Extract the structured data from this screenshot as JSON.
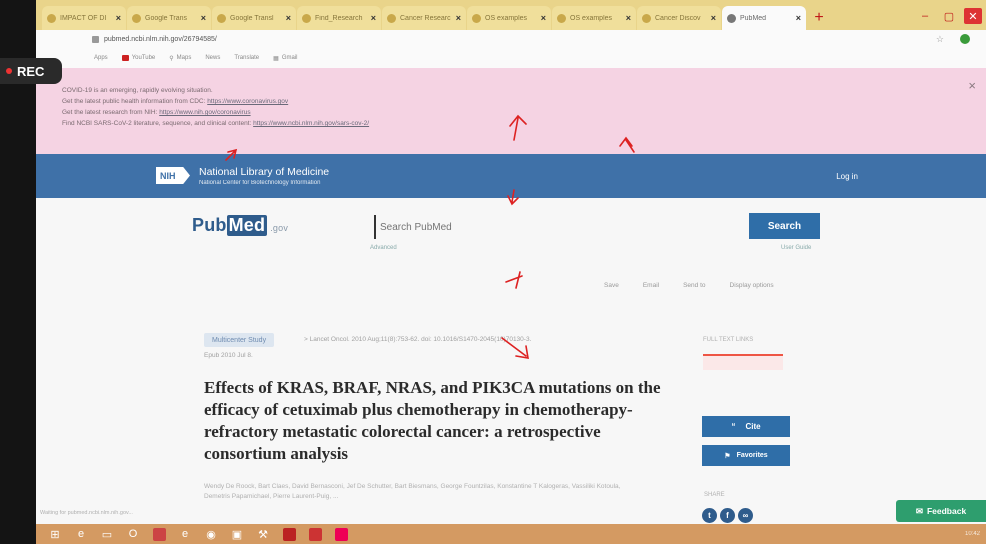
{
  "browser": {
    "tabs": [
      {
        "label": "IMPACT OF DI"
      },
      {
        "label": "Google Trans"
      },
      {
        "label": "Google Transl"
      },
      {
        "label": "Find_Research"
      },
      {
        "label": "Cancer Researc"
      },
      {
        "label": "OS examples"
      },
      {
        "label": "OS examples"
      },
      {
        "label": "Cancer Discov"
      },
      {
        "label": "PubMed"
      }
    ],
    "new_tab": "+",
    "address": "pubmed.ncbi.nlm.nih.gov/26794585/",
    "bookmarks": [
      "Apps",
      "YouTube",
      "Maps",
      "News",
      "Translate",
      "Gmail"
    ]
  },
  "recording": {
    "label": "REC"
  },
  "alert": {
    "line1": "COVID-19 is an emerging, rapidly evolving situation.",
    "line2_prefix": "Get the latest public health information from CDC: ",
    "line2_link": "https://www.coronavirus.gov",
    "line3_prefix": "Get the latest research from NIH: ",
    "line3_link": "https://www.nih.gov/coronavirus",
    "line4_prefix": "Find NCBI SARS-CoV-2 literature, sequence, and clinical content: ",
    "line4_link": "https://www.ncbi.nlm.nih.gov/sars-cov-2/",
    "close": "×"
  },
  "nih_header": {
    "logo": "NIH",
    "title": "National Library of Medicine",
    "subtitle": "National Center for Biotechnology Information",
    "login": "Log in"
  },
  "search": {
    "logo_pub": "Pub",
    "logo_med": "Med",
    "logo_gov": ".gov",
    "placeholder": "Search PubMed",
    "button": "Search",
    "advanced": "Advanced",
    "user_guide": "User Guide"
  },
  "actions": [
    "Save",
    "Email",
    "Send to",
    "Display options"
  ],
  "article": {
    "type_badge": "Multicenter Study",
    "journal_line1": "> Lancet Oncol. 2010 Aug;11(8):753-62. doi: 10.1016/S1470-2045(10)70130-3.",
    "journal_line2": "Epub 2010 Jul 8.",
    "title": "Effects of KRAS, BRAF, NRAS, and PIK3CA mutations on the efficacy of cetuximab plus chemotherapy in chemotherapy-refractory metastatic colorectal cancer: a retrospective consortium analysis",
    "authors": "Wendy De Roock, Bart Claes, David Bernasconi, Jef De Schutter, Bart Biesmans, George Fountzilas, Konstantine T Kalogeras, Vassiliki Kotoula, Demetris Papamichael, Pierre Laurent-Puig, ..."
  },
  "sidebar": {
    "full_text_label": "FULL TEXT LINKS",
    "cite": "Cite",
    "favorites": "Favorites",
    "share_label": "SHARE"
  },
  "feedback": "Feedback",
  "statusbar": "Waiting for pubmed.ncbi.nlm.nih.gov...",
  "taskbar": {
    "clock": "10:42"
  }
}
